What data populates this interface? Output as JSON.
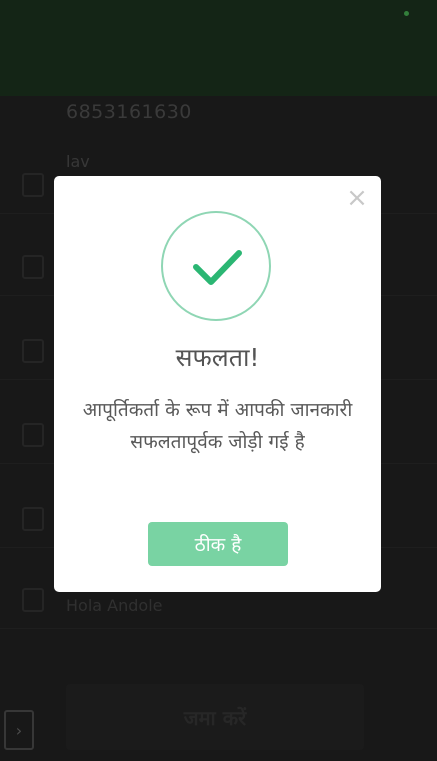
{
  "background": {
    "phone_number": "6853161630",
    "small_label": "lav",
    "field_text": "Hola Andole",
    "submit_label": "जमा करें",
    "side_button_glyph": "›"
  },
  "modal": {
    "close_glyph": "×",
    "icon": "checkmark-icon",
    "title": "सफलता!",
    "message": "आपूर्तिकर्ता के रूप में आपकी जानकारी सफलतापूर्वक जोड़ी गई है",
    "ok_label": "ठीक है"
  },
  "colors": {
    "header_green": "#1f3a22",
    "accent_green": "#2bb673",
    "ring_green": "#8fd6b4",
    "button_green": "#79d3a3"
  }
}
